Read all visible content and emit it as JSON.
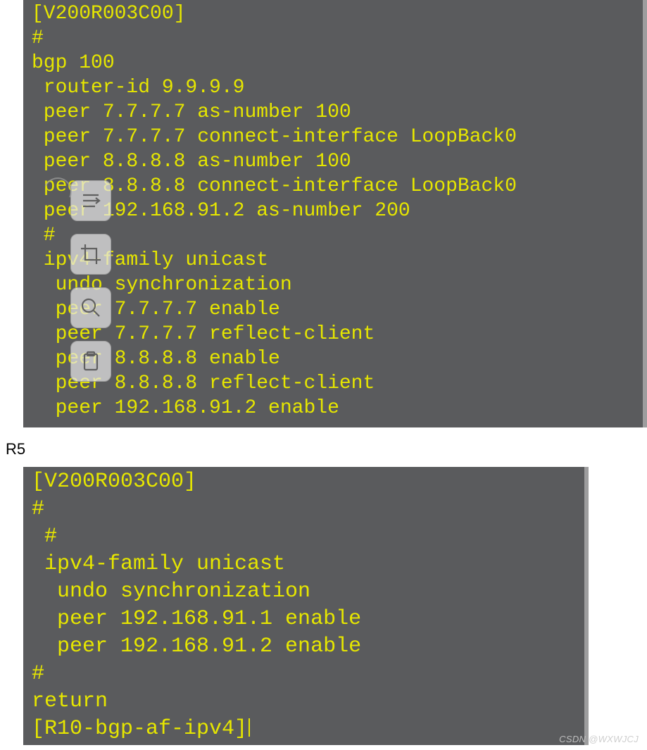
{
  "watermark": "CSDN @WXWJCJ",
  "label_r5": "R5",
  "terminal1": {
    "lines": "[V200R003C00]\n#\nbgp 100\n router-id 9.9.9.9\n peer 7.7.7.7 as-number 100\n peer 7.7.7.7 connect-interface LoopBack0\n peer 8.8.8.8 as-number 100\n peer 8.8.8.8 connect-interface LoopBack0\n peer 192.168.91.2 as-number 200\n #\n ipv4-family unicast\n  undo synchronization\n  peer 7.7.7.7 enable\n  peer 7.7.7.7 reflect-client\n  peer 8.8.8.8 enable\n  peer 8.8.8.8 reflect-client\n  peer 192.168.91.2 enable"
  },
  "terminal2": {
    "lines": "[V200R003C00]\n#\n #\n ipv4-family unicast\n  undo synchronization\n  peer 192.168.91.1 enable\n  peer 192.168.91.2 enable\n#\nreturn\n[R10-bgp-af-ipv4]"
  },
  "toolbar": {
    "items": [
      "list-icon",
      "crop-icon",
      "search-icon",
      "clipboard-icon"
    ]
  }
}
